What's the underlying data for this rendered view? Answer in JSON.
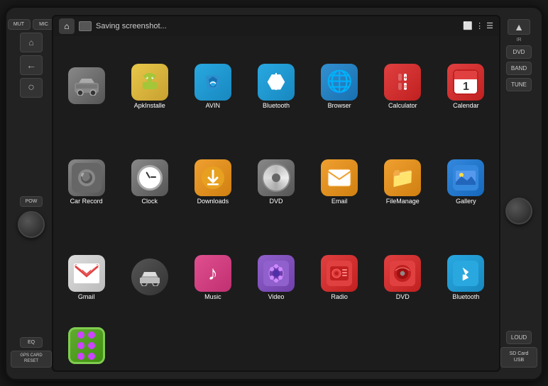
{
  "device": {
    "left_panel": {
      "buttons": [
        {
          "id": "mut",
          "label": "MUT"
        },
        {
          "id": "mic",
          "label": "MIC"
        },
        {
          "id": "pow",
          "label": "POW"
        },
        {
          "id": "eq",
          "label": "EQ"
        },
        {
          "id": "gps",
          "label": "GPS CARD RESET"
        }
      ],
      "nav_buttons": [
        "⌂",
        "←",
        "○"
      ]
    },
    "status_bar": {
      "saving_text": "Saving screenshot...",
      "icons": [
        "□□",
        "□",
        "⋮",
        "☰"
      ]
    },
    "apps": [
      {
        "id": "apk",
        "label": "ApkInstalle",
        "icon_type": "apk"
      },
      {
        "id": "avin",
        "label": "AVIN",
        "icon_type": "avin"
      },
      {
        "id": "bluetooth1",
        "label": "Bluetooth",
        "icon_type": "bluetooth"
      },
      {
        "id": "browser",
        "label": "Browser",
        "icon_type": "browser"
      },
      {
        "id": "calculator",
        "label": "Calculator",
        "icon_type": "calculator"
      },
      {
        "id": "calendar",
        "label": "Calendar",
        "icon_type": "calendar"
      },
      {
        "id": "carrecord",
        "label": "Car Record",
        "icon_type": "carrecord"
      },
      {
        "id": "clock",
        "label": "Clock",
        "icon_type": "clock"
      },
      {
        "id": "downloads",
        "label": "Downloads",
        "icon_type": "downloads"
      },
      {
        "id": "dvd1",
        "label": "DVD",
        "icon_type": "dvd"
      },
      {
        "id": "email",
        "label": "Email",
        "icon_type": "email"
      },
      {
        "id": "filemanager",
        "label": "FileManage",
        "icon_type": "filemanager"
      },
      {
        "id": "gallery",
        "label": "Gallery",
        "icon_type": "gallery"
      },
      {
        "id": "gmail",
        "label": "Gmail",
        "icon_type": "gmail"
      },
      {
        "id": "music",
        "label": "Music",
        "icon_type": "music"
      },
      {
        "id": "video",
        "label": "Video",
        "icon_type": "video"
      },
      {
        "id": "radio",
        "label": "Radio",
        "icon_type": "radio"
      },
      {
        "id": "dvd2",
        "label": "DVD",
        "icon_type": "dvd2"
      },
      {
        "id": "bluetooth2",
        "label": "Bluetooth",
        "icon_type": "bluetooth2"
      },
      {
        "id": "dots",
        "label": "",
        "icon_type": "dots"
      },
      {
        "id": "car_item",
        "label": "",
        "icon_type": "car_item"
      }
    ],
    "right_panel": {
      "buttons": [
        {
          "id": "dvd_btn",
          "label": "DVD"
        },
        {
          "id": "band_btn",
          "label": "BAND"
        },
        {
          "id": "tune_btn",
          "label": "TUNE"
        },
        {
          "id": "loud_btn",
          "label": "LOUD"
        },
        {
          "id": "sdcard_btn",
          "label": "SD Card USB"
        }
      ]
    }
  }
}
